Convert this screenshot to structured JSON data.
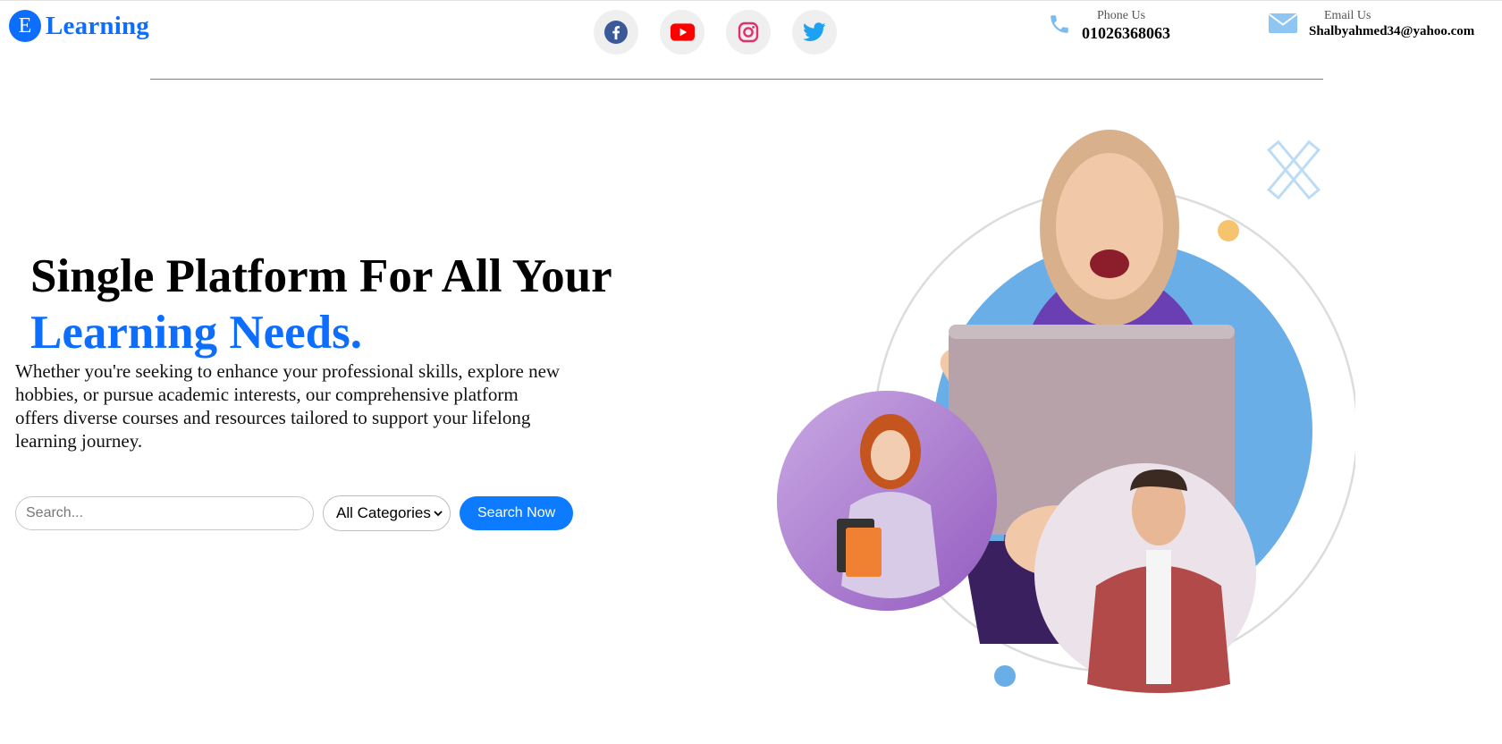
{
  "brand": {
    "badge": "E",
    "name": "Learning"
  },
  "socials": [
    {
      "name": "Facebook",
      "icon": "facebook-icon",
      "color": "#3b5998"
    },
    {
      "name": "YouTube",
      "icon": "youtube-icon",
      "color": "#ff0000"
    },
    {
      "name": "Instagram",
      "icon": "instagram-icon",
      "color": "#e1306c"
    },
    {
      "name": "Twitter",
      "icon": "twitter-icon",
      "color": "#1da1f2"
    }
  ],
  "contact": {
    "phone": {
      "label": "Phone Us",
      "value": "01026368063",
      "icon": "phone-icon"
    },
    "email": {
      "label": "Email Us",
      "value": "Shalbyahmed34@yahoo.com",
      "icon": "envelope-icon"
    }
  },
  "hero": {
    "headline": "Single Platform For All Your",
    "headline_accent": "Learning Needs.",
    "description": "Whether you're seeking to enhance your professional skills, explore new hobbies, or pursue academic interests, our comprehensive platform offers diverse courses and resources tailored to support your lifelong learning journey."
  },
  "search": {
    "placeholder": "Search...",
    "category_selected": "All Categories",
    "button_label": "Search Now"
  },
  "colors": {
    "brand": "#0d6efd",
    "button": "#0d7bff",
    "blob": "#6aaee8",
    "icon_light": "#7bbcf0"
  }
}
